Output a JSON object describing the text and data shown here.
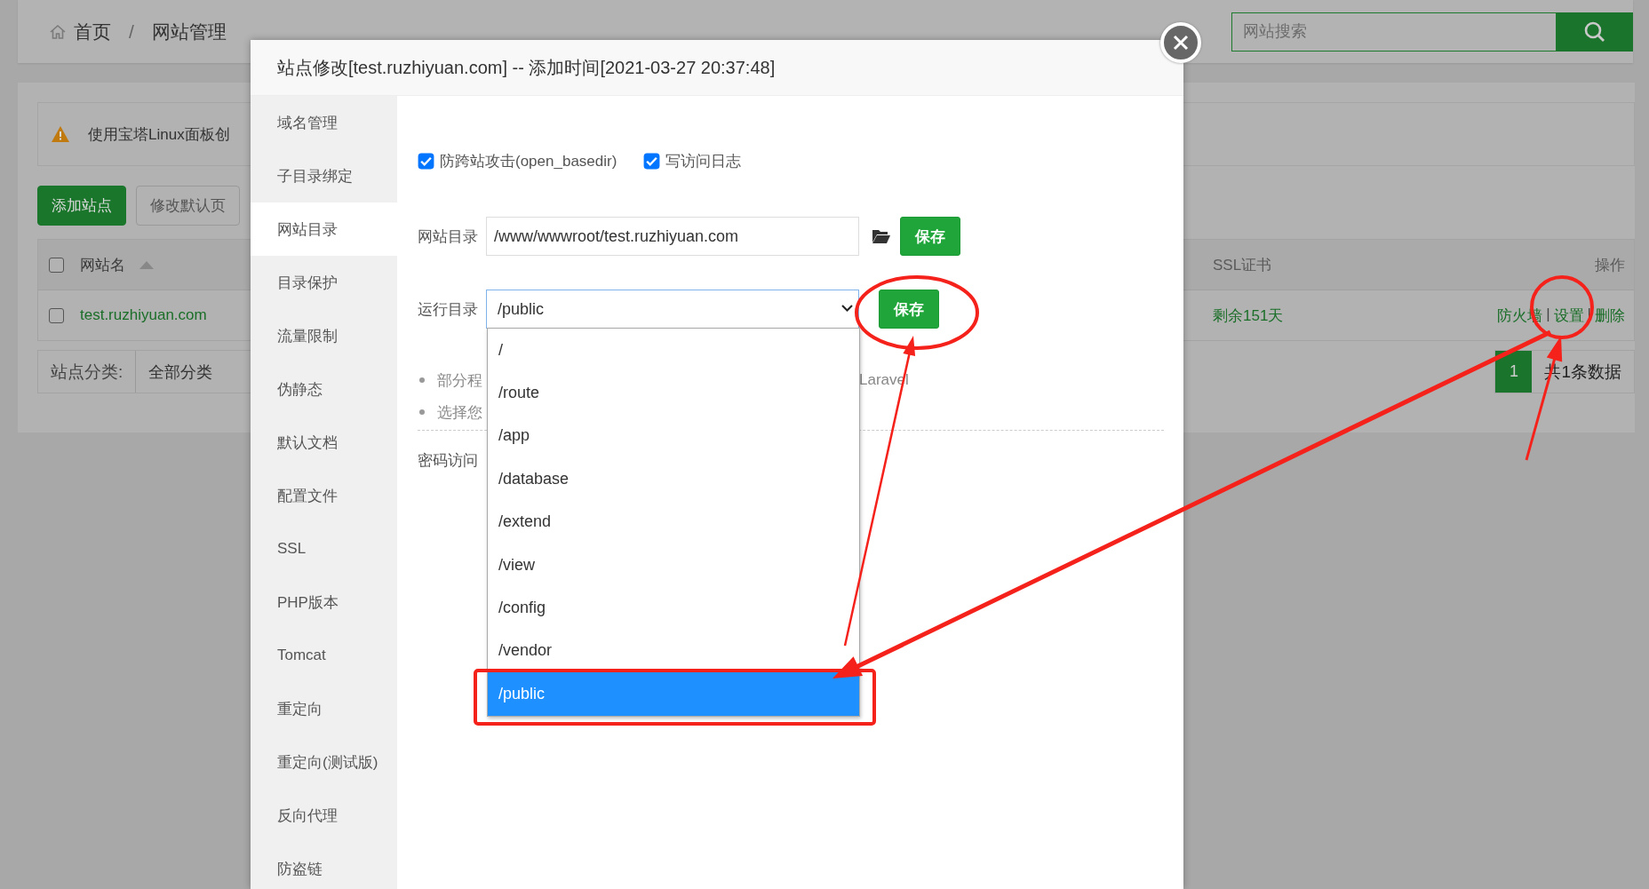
{
  "breadcrumb": {
    "items": [
      "首页",
      "网站管理"
    ],
    "separator": "/"
  },
  "search": {
    "placeholder": "网站搜索"
  },
  "alert": {
    "text": "使用宝塔Linux面板创"
  },
  "toolbar": [
    "添加站点",
    "修改默认页"
  ],
  "table": {
    "header_checked": false,
    "columns": [
      {
        "label": "网站名",
        "sorted": true
      },
      {
        "label": "SSL证书",
        "sorted": false
      },
      {
        "label": "操作",
        "sorted": false
      }
    ],
    "action_separator": "|",
    "rows": [
      {
        "checked": false,
        "name": "test.ruzhiyuan.com",
        "ssl": "剩余151天",
        "actions": [
          "防火墙",
          "设置",
          "删除"
        ]
      }
    ]
  },
  "category": {
    "label": "站点分类:",
    "value": "全部分类"
  },
  "pagination": {
    "pages": [
      {
        "label": "1",
        "selected": true
      }
    ],
    "total": "共1条数据"
  },
  "modal": {
    "title": "站点修改[test.ruzhiyuan.com] -- 添加时间[2021-03-27 20:37:48]",
    "sidebar": [
      {
        "label": "域名管理",
        "selected": false
      },
      {
        "label": "子目录绑定",
        "selected": false
      },
      {
        "label": "网站目录",
        "selected": true
      },
      {
        "label": "目录保护",
        "selected": false
      },
      {
        "label": "流量限制",
        "selected": false
      },
      {
        "label": "伪静态",
        "selected": false
      },
      {
        "label": "默认文档",
        "selected": false
      },
      {
        "label": "配置文件",
        "selected": false
      },
      {
        "label": "SSL",
        "selected": false
      },
      {
        "label": "PHP版本",
        "selected": false
      },
      {
        "label": "Tomcat",
        "selected": false
      },
      {
        "label": "重定向",
        "selected": false
      },
      {
        "label": "重定向(测试版)",
        "selected": false
      },
      {
        "label": "反向代理",
        "selected": false
      },
      {
        "label": "防盗链",
        "selected": false
      }
    ],
    "options": [
      {
        "label": "防跨站攻击(open_basedir)",
        "checked": true
      },
      {
        "label": "写访问日志",
        "checked": true
      }
    ],
    "site_dir": {
      "label": "网站目录",
      "value": "/www/wwwroot/test.ruzhiyuan.com",
      "button": "保存"
    },
    "run_dir": {
      "label": "运行目录",
      "value": "/public",
      "button": "保存",
      "expanded": true,
      "options": [
        {
          "label": "/",
          "selected": false
        },
        {
          "label": "/route",
          "selected": false
        },
        {
          "label": "/app",
          "selected": false
        },
        {
          "label": "/database",
          "selected": false
        },
        {
          "label": "/extend",
          "selected": false
        },
        {
          "label": "/view",
          "selected": false
        },
        {
          "label": "/config",
          "selected": false
        },
        {
          "label": "/vendor",
          "selected": false
        },
        {
          "label": "/public",
          "selected": true
        }
      ]
    },
    "notes": [
      {
        "parts": [
          "部分程",
          "Laravel"
        ]
      },
      {
        "parts": [
          "选择您"
        ]
      }
    ],
    "password_access": "密码访问"
  }
}
